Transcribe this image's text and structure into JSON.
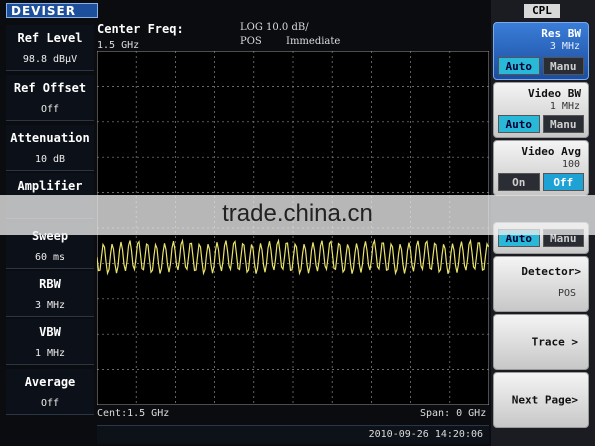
{
  "header": {
    "logo_text": "DEVISER",
    "center_freq_label": "Center Freq:",
    "center_freq_value": "1.5 GHz",
    "log_scale": "LOG 10.0 dB/",
    "detector_mode": "POS",
    "trigger_mode": "Immediate"
  },
  "left_panel": [
    {
      "title": "Ref Level",
      "value": "98.8 dBµV"
    },
    {
      "title": "Ref Offset",
      "value": "Off"
    },
    {
      "title": "Attenuation",
      "value": "10 dB"
    },
    {
      "title": "Amplifier",
      "value": ""
    },
    {
      "title": "Sweep",
      "value": "60 ms"
    },
    {
      "title": "RBW",
      "value": "3 MHz"
    },
    {
      "title": "VBW",
      "value": "1 MHz"
    },
    {
      "title": "Average",
      "value": "Off"
    }
  ],
  "graticule": {
    "cent_label": "Cent:1.5 GHz",
    "span_label": "Span:  0 GHz",
    "trace_color": "#e9e36a",
    "grid_color": "#8a8a8a"
  },
  "status": {
    "datetime": "2010-09-26 14:20:06"
  },
  "softkeys": {
    "menu_title": "CPL",
    "res_bw": {
      "label": "Res BW",
      "value": "3 MHz",
      "auto": "Auto",
      "manu": "Manu"
    },
    "video_bw": {
      "label": "Video BW",
      "value": "1 MHz",
      "auto": "Auto",
      "manu": "Manu"
    },
    "video_avg": {
      "label": "Video Avg",
      "value": "100",
      "on": "On",
      "off": "Off"
    },
    "sweep_pair": {
      "auto": "Auto",
      "manu": "Manu"
    },
    "detector": {
      "label": "Detector>",
      "value": "POS"
    },
    "trace": {
      "label": "Trace >"
    },
    "next_page": {
      "label": "Next Page>"
    }
  },
  "watermark": "trade.china.cn"
}
